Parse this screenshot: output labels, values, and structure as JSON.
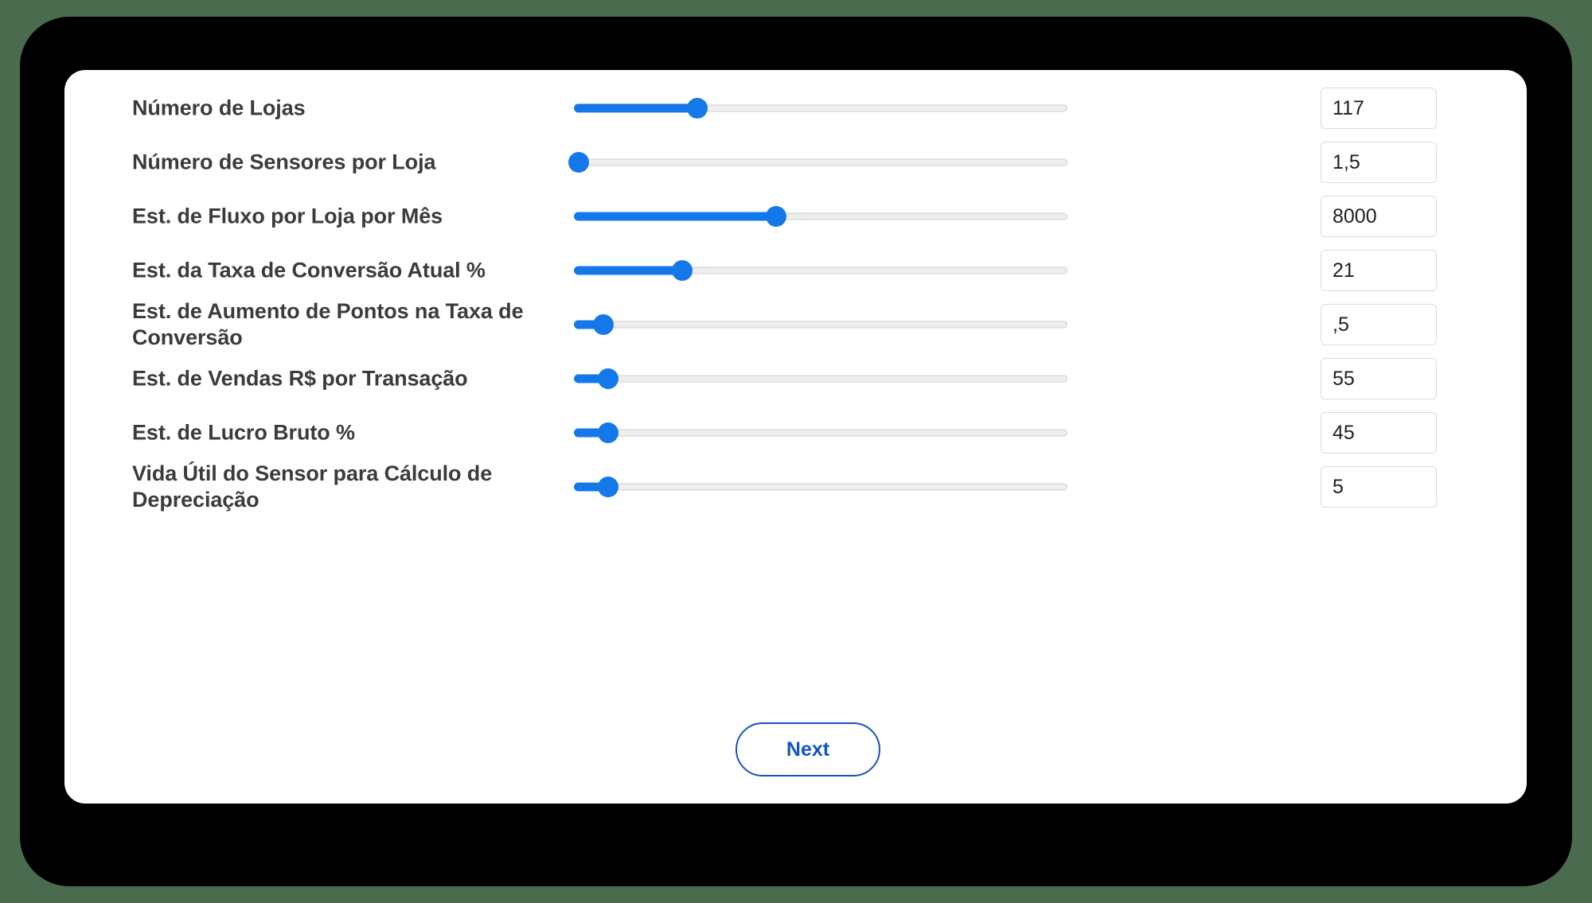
{
  "theme": {
    "page_background": "#4a6b4d",
    "frame_color": "#000000",
    "card_background": "#ffffff",
    "accent_blue": "#1578e8",
    "button_blue": "#1155c4",
    "label_color": "#3b3b3b",
    "track_color": "#eeeeee"
  },
  "form": {
    "rows": [
      {
        "label": "Número de Lojas",
        "value": "117",
        "slider_percent": 25
      },
      {
        "label": "Número de Sensores por Loja",
        "value": "1,5",
        "slider_percent": 1
      },
      {
        "label": "Est. de Fluxo por Loja por Mês",
        "value": "8000",
        "slider_percent": 41
      },
      {
        "label": "Est. da Taxa de Conversão Atual %",
        "value": "21",
        "slider_percent": 22
      },
      {
        "label": "Est. de Aumento de Pontos na Taxa de Conversão",
        "value": ",5",
        "slider_percent": 6
      },
      {
        "label": "Est. de Vendas R$ por Transação",
        "value": "55",
        "slider_percent": 7
      },
      {
        "label": "Est. de Lucro Bruto %",
        "value": "45",
        "slider_percent": 7
      },
      {
        "label": "Vida Útil do Sensor para Cálculo de Depreciação",
        "value": "5",
        "slider_percent": 7
      }
    ]
  },
  "footer": {
    "next_label": "Next"
  }
}
